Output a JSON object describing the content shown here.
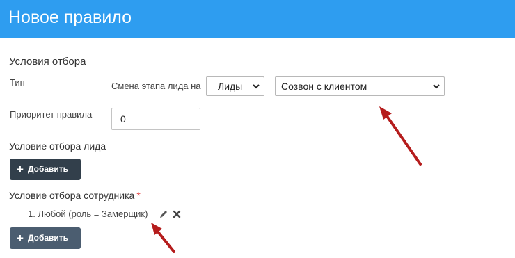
{
  "header": {
    "title": "Новое правило"
  },
  "conditions": {
    "section_title": "Условия отбора",
    "type_label": "Тип",
    "stage_change_label": "Смена этапа лида на",
    "entity_select": {
      "value": "Лиды"
    },
    "stage_select": {
      "value": "Созвон с клиентом"
    },
    "priority_label": "Приоритет правила",
    "priority_value": "0"
  },
  "lead_condition": {
    "title": "Условие отбора лида",
    "add_button": "Добавить"
  },
  "employee_condition": {
    "title": "Условие отбора сотрудника",
    "required_mark": "*",
    "items": [
      {
        "text": "1. Любой (роль = Замерщик)"
      }
    ],
    "add_button": "Добавить"
  },
  "colors": {
    "header": "#2e9df0",
    "button_dark": "#323f4b",
    "button_slate": "#4b5d70",
    "arrow": "#b51c1c",
    "required": "#e34b4b"
  },
  "icons": {
    "edit": "pencil-icon",
    "delete": "close-icon",
    "add": "plus-icon",
    "dropdown": "chevron-down-icon"
  }
}
